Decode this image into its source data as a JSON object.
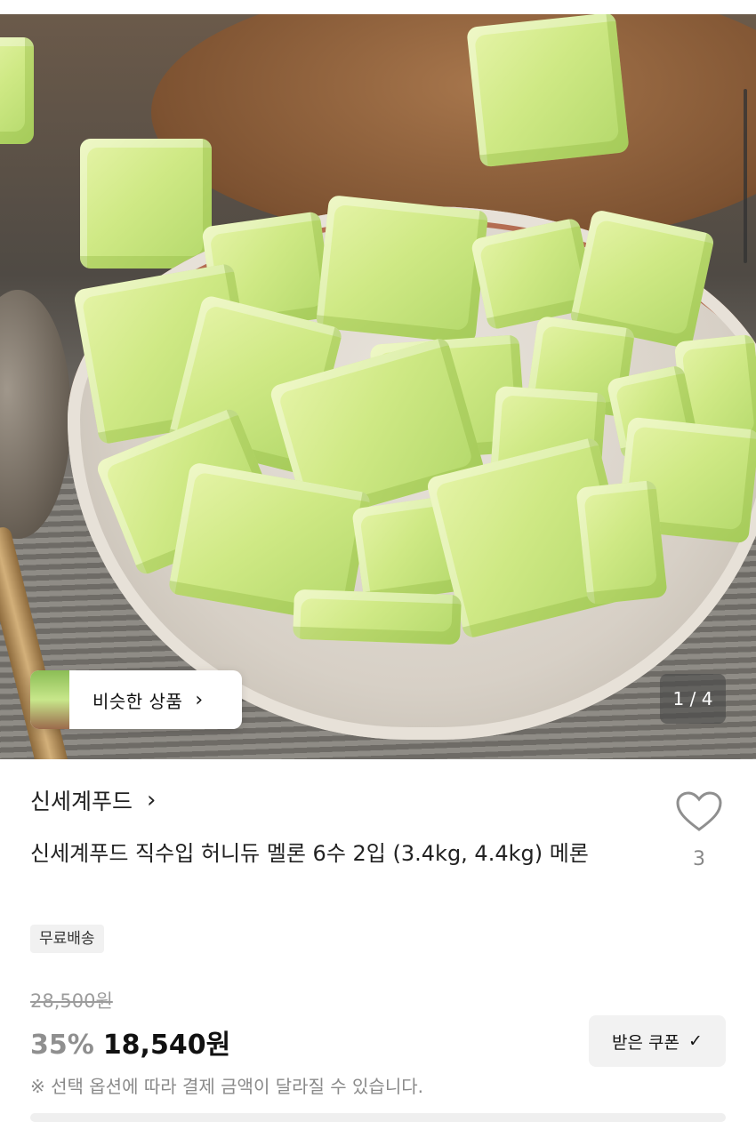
{
  "gallery": {
    "similar_label": "비슷한 상품",
    "counter": "1 / 4"
  },
  "seller": {
    "name": "신세계푸드"
  },
  "product": {
    "title": "신세계푸드 직수입 허니듀 멜론 6수 2입 (3.4kg, 4.4kg) 메론",
    "wish_count": "3",
    "shipping_badge": "무료배송"
  },
  "pricing": {
    "original": "28,500원",
    "discount": "35%",
    "sale": "18,540원",
    "coupon_label": "받은 쿠폰",
    "note": "※ 선택 옵션에 따라 결제 금액이 달라질 수 있습니다."
  }
}
